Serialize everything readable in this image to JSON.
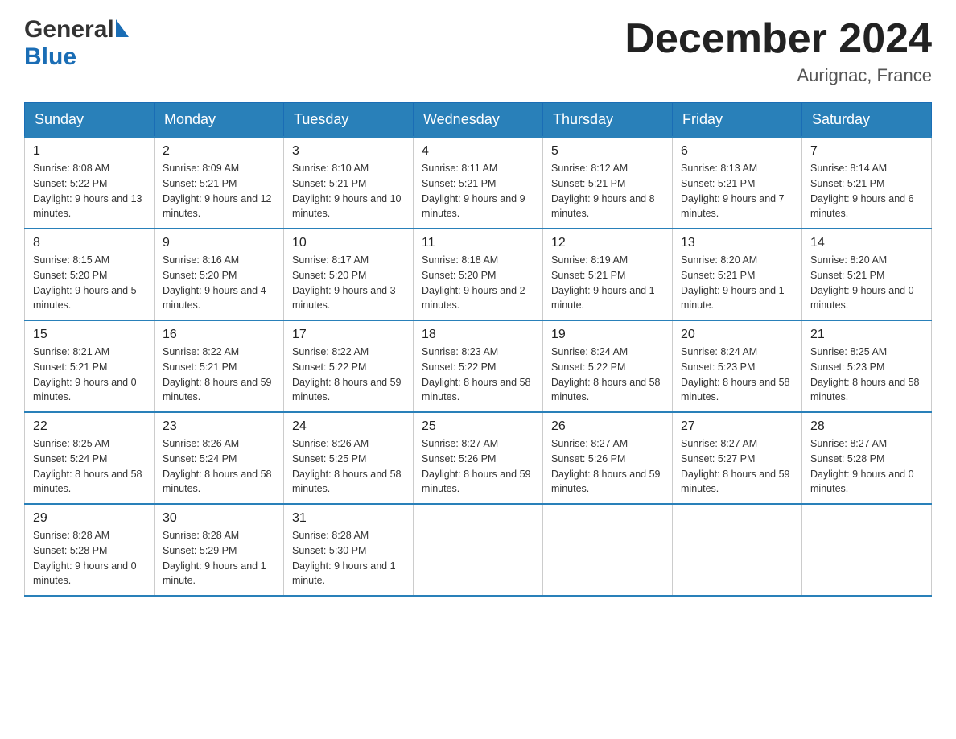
{
  "logo": {
    "general": "General",
    "blue": "Blue"
  },
  "title": {
    "month": "December 2024",
    "location": "Aurignac, France"
  },
  "days_of_week": [
    "Sunday",
    "Monday",
    "Tuesday",
    "Wednesday",
    "Thursday",
    "Friday",
    "Saturday"
  ],
  "weeks": [
    [
      {
        "day": "1",
        "sunrise": "8:08 AM",
        "sunset": "5:22 PM",
        "daylight": "9 hours and 13 minutes."
      },
      {
        "day": "2",
        "sunrise": "8:09 AM",
        "sunset": "5:21 PM",
        "daylight": "9 hours and 12 minutes."
      },
      {
        "day": "3",
        "sunrise": "8:10 AM",
        "sunset": "5:21 PM",
        "daylight": "9 hours and 10 minutes."
      },
      {
        "day": "4",
        "sunrise": "8:11 AM",
        "sunset": "5:21 PM",
        "daylight": "9 hours and 9 minutes."
      },
      {
        "day": "5",
        "sunrise": "8:12 AM",
        "sunset": "5:21 PM",
        "daylight": "9 hours and 8 minutes."
      },
      {
        "day": "6",
        "sunrise": "8:13 AM",
        "sunset": "5:21 PM",
        "daylight": "9 hours and 7 minutes."
      },
      {
        "day": "7",
        "sunrise": "8:14 AM",
        "sunset": "5:21 PM",
        "daylight": "9 hours and 6 minutes."
      }
    ],
    [
      {
        "day": "8",
        "sunrise": "8:15 AM",
        "sunset": "5:20 PM",
        "daylight": "9 hours and 5 minutes."
      },
      {
        "day": "9",
        "sunrise": "8:16 AM",
        "sunset": "5:20 PM",
        "daylight": "9 hours and 4 minutes."
      },
      {
        "day": "10",
        "sunrise": "8:17 AM",
        "sunset": "5:20 PM",
        "daylight": "9 hours and 3 minutes."
      },
      {
        "day": "11",
        "sunrise": "8:18 AM",
        "sunset": "5:20 PM",
        "daylight": "9 hours and 2 minutes."
      },
      {
        "day": "12",
        "sunrise": "8:19 AM",
        "sunset": "5:21 PM",
        "daylight": "9 hours and 1 minute."
      },
      {
        "day": "13",
        "sunrise": "8:20 AM",
        "sunset": "5:21 PM",
        "daylight": "9 hours and 1 minute."
      },
      {
        "day": "14",
        "sunrise": "8:20 AM",
        "sunset": "5:21 PM",
        "daylight": "9 hours and 0 minutes."
      }
    ],
    [
      {
        "day": "15",
        "sunrise": "8:21 AM",
        "sunset": "5:21 PM",
        "daylight": "9 hours and 0 minutes."
      },
      {
        "day": "16",
        "sunrise": "8:22 AM",
        "sunset": "5:21 PM",
        "daylight": "8 hours and 59 minutes."
      },
      {
        "day": "17",
        "sunrise": "8:22 AM",
        "sunset": "5:22 PM",
        "daylight": "8 hours and 59 minutes."
      },
      {
        "day": "18",
        "sunrise": "8:23 AM",
        "sunset": "5:22 PM",
        "daylight": "8 hours and 58 minutes."
      },
      {
        "day": "19",
        "sunrise": "8:24 AM",
        "sunset": "5:22 PM",
        "daylight": "8 hours and 58 minutes."
      },
      {
        "day": "20",
        "sunrise": "8:24 AM",
        "sunset": "5:23 PM",
        "daylight": "8 hours and 58 minutes."
      },
      {
        "day": "21",
        "sunrise": "8:25 AM",
        "sunset": "5:23 PM",
        "daylight": "8 hours and 58 minutes."
      }
    ],
    [
      {
        "day": "22",
        "sunrise": "8:25 AM",
        "sunset": "5:24 PM",
        "daylight": "8 hours and 58 minutes."
      },
      {
        "day": "23",
        "sunrise": "8:26 AM",
        "sunset": "5:24 PM",
        "daylight": "8 hours and 58 minutes."
      },
      {
        "day": "24",
        "sunrise": "8:26 AM",
        "sunset": "5:25 PM",
        "daylight": "8 hours and 58 minutes."
      },
      {
        "day": "25",
        "sunrise": "8:27 AM",
        "sunset": "5:26 PM",
        "daylight": "8 hours and 59 minutes."
      },
      {
        "day": "26",
        "sunrise": "8:27 AM",
        "sunset": "5:26 PM",
        "daylight": "8 hours and 59 minutes."
      },
      {
        "day": "27",
        "sunrise": "8:27 AM",
        "sunset": "5:27 PM",
        "daylight": "8 hours and 59 minutes."
      },
      {
        "day": "28",
        "sunrise": "8:27 AM",
        "sunset": "5:28 PM",
        "daylight": "9 hours and 0 minutes."
      }
    ],
    [
      {
        "day": "29",
        "sunrise": "8:28 AM",
        "sunset": "5:28 PM",
        "daylight": "9 hours and 0 minutes."
      },
      {
        "day": "30",
        "sunrise": "8:28 AM",
        "sunset": "5:29 PM",
        "daylight": "9 hours and 1 minute."
      },
      {
        "day": "31",
        "sunrise": "8:28 AM",
        "sunset": "5:30 PM",
        "daylight": "9 hours and 1 minute."
      },
      null,
      null,
      null,
      null
    ]
  ]
}
